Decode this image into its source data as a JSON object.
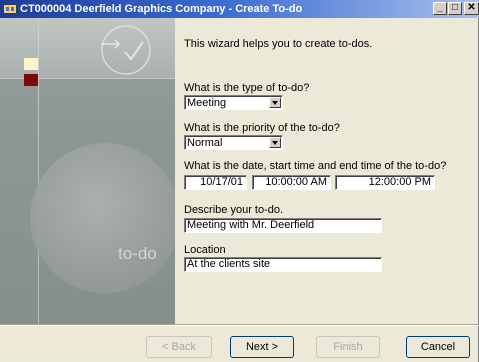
{
  "window": {
    "title": "CT000004 Deerfield Graphics Company - Create To-do",
    "min_glyph": "_",
    "max_glyph": "□",
    "close_glyph": "✕"
  },
  "side": {
    "text": "to-do"
  },
  "wizard": {
    "intro": "This wizard helps you to create to-dos.",
    "type_label": "What is the type of to-do?",
    "type_value": "Meeting",
    "priority_label": "What is the priority of the to-do?",
    "priority_value": "Normal",
    "datetime_label": "What is the date, start time and end time of the to-do?",
    "date_value": "10/17/01",
    "start_time_value": "10:00:00 AM",
    "end_time_value": "12:00:00 PM",
    "describe_label": "Describe your to-do.",
    "describe_value": "Meeting with Mr. Deerfield",
    "location_label": "Location",
    "location_value": "At the clients site"
  },
  "buttons": {
    "back": "< Back",
    "next": "Next >",
    "finish": "Finish",
    "cancel": "Cancel"
  }
}
